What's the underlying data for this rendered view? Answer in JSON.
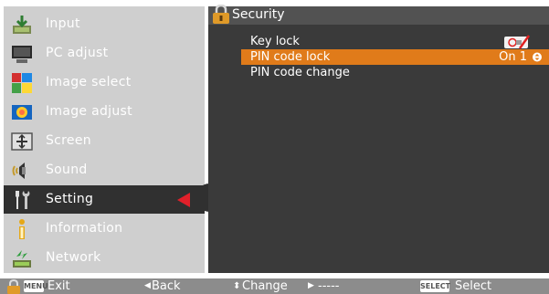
{
  "sidebar": {
    "items": [
      {
        "label": "Input",
        "icon": "input-icon"
      },
      {
        "label": "PC adjust",
        "icon": "pc-adjust-icon"
      },
      {
        "label": "Image select",
        "icon": "image-select-icon"
      },
      {
        "label": "Image adjust",
        "icon": "image-adjust-icon"
      },
      {
        "label": "Screen",
        "icon": "screen-icon"
      },
      {
        "label": "Sound",
        "icon": "sound-icon"
      },
      {
        "label": "Setting",
        "icon": "setting-icon",
        "selected": true
      },
      {
        "label": "Information",
        "icon": "information-icon"
      },
      {
        "label": "Network",
        "icon": "network-icon"
      }
    ]
  },
  "panel": {
    "title": "Security",
    "title_icon": "padlock-icon",
    "rows": [
      {
        "label": "Key lock",
        "icon": "remote-lock-icon"
      },
      {
        "label": "PIN code lock",
        "value": "On 1",
        "highlighted": true
      },
      {
        "label": "PIN code change"
      }
    ]
  },
  "bottom_bar": {
    "menu_badge": "MENU",
    "exit": "Exit",
    "back": "Back",
    "change": "Change",
    "dashes": "-----",
    "select_badge": "SELECT",
    "select": "Select"
  },
  "colors": {
    "highlight": "#e07b1a",
    "panel": "#3a3a3a",
    "sidebar": "#cfcfcf",
    "selected_item": "#303030",
    "selection_arrow": "#e0202a"
  }
}
